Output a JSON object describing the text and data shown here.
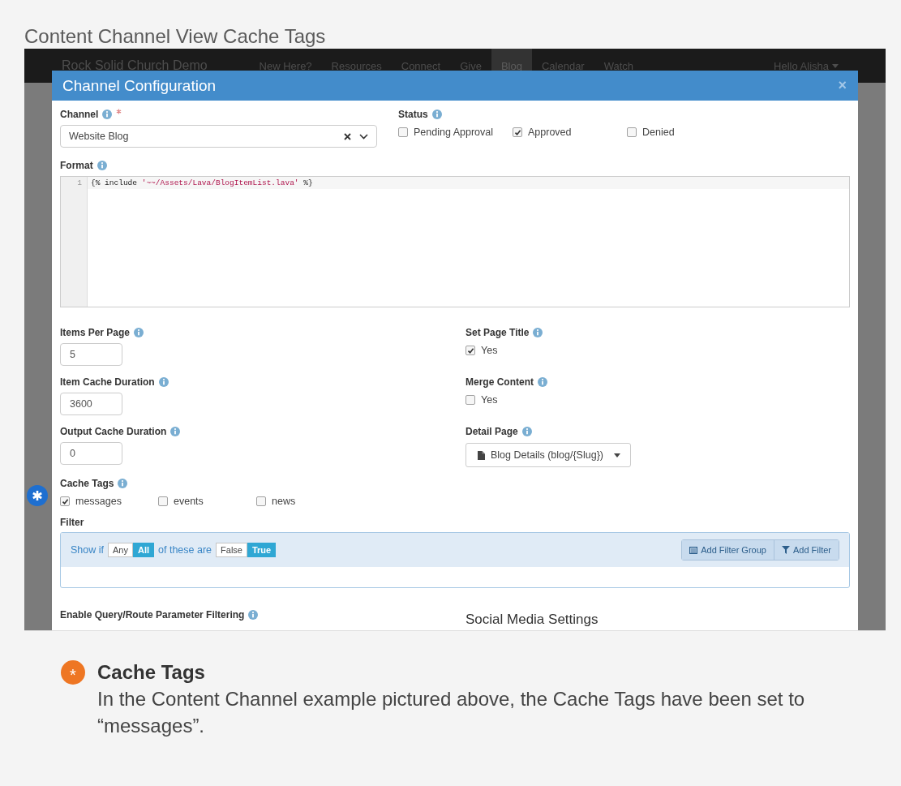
{
  "page_title": "Content Channel View Cache Tags",
  "navbar": {
    "brand": "Rock Solid Church Demo",
    "items": [
      {
        "label": "New Here?",
        "selected": false
      },
      {
        "label": "Resources",
        "selected": false
      },
      {
        "label": "Connect",
        "selected": false
      },
      {
        "label": "Give",
        "selected": false
      },
      {
        "label": "Blog",
        "selected": true
      },
      {
        "label": "Calendar",
        "selected": false
      },
      {
        "label": "Watch",
        "selected": false
      }
    ],
    "user_menu": "Hello Alisha"
  },
  "modal": {
    "title": "Channel Configuration",
    "close": "×",
    "channel": {
      "label": "Channel",
      "required": true,
      "value": "Website Blog"
    },
    "status": {
      "label": "Status",
      "options": [
        {
          "label": "Pending Approval",
          "checked": false
        },
        {
          "label": "Approved",
          "checked": true
        },
        {
          "label": "Denied",
          "checked": false
        }
      ]
    },
    "format": {
      "label": "Format",
      "lines": [
        {
          "number": "1",
          "tokens": [
            {
              "text": "{% include ",
              "kind": "keyword"
            },
            {
              "text": "'~~/Assets/Lava/BlogItemList.lava'",
              "kind": "string"
            },
            {
              "text": " %}",
              "kind": "keyword"
            }
          ]
        }
      ]
    },
    "rows": [
      {
        "left": {
          "kind": "input",
          "label": "Items Per Page",
          "value": "5"
        },
        "right": {
          "kind": "checks",
          "label": "Set Page Title",
          "options": [
            {
              "label": "Yes",
              "checked": true
            }
          ]
        }
      },
      {
        "left": {
          "kind": "input",
          "label": "Item Cache Duration",
          "value": "3600"
        },
        "right": {
          "kind": "checks",
          "label": "Merge Content",
          "options": [
            {
              "label": "Yes",
              "checked": false
            }
          ]
        }
      },
      {
        "left": {
          "kind": "input",
          "label": "Output Cache Duration",
          "value": "0"
        },
        "right": {
          "kind": "page",
          "label": "Detail Page",
          "value": "Blog Details (blog/{Slug})"
        }
      }
    ],
    "cache_tags": {
      "label": "Cache Tags",
      "options": [
        {
          "label": "messages",
          "checked": true
        },
        {
          "label": "events",
          "checked": false
        },
        {
          "label": "news",
          "checked": false
        }
      ]
    },
    "filter": {
      "label": "Filter",
      "show_if": "Show if",
      "match": [
        {
          "label": "Any",
          "selected": false
        },
        {
          "label": "All",
          "selected": true
        }
      ],
      "of_these_are": "of these are",
      "truth": [
        {
          "label": "False",
          "selected": false
        },
        {
          "label": "True",
          "selected": true
        }
      ],
      "buttons": [
        {
          "label": "Add Filter Group",
          "kind": "group"
        },
        {
          "label": "Add Filter",
          "kind": "filter"
        }
      ]
    },
    "query_filtering": {
      "label": "Enable Query/Route Parameter Filtering"
    },
    "social_heading": "Social Media Settings"
  },
  "callout": {
    "marker": "*",
    "title": "Cache Tags",
    "text": "In the Content Channel example pictured above, the Cache Tags have been set to “messages”."
  }
}
